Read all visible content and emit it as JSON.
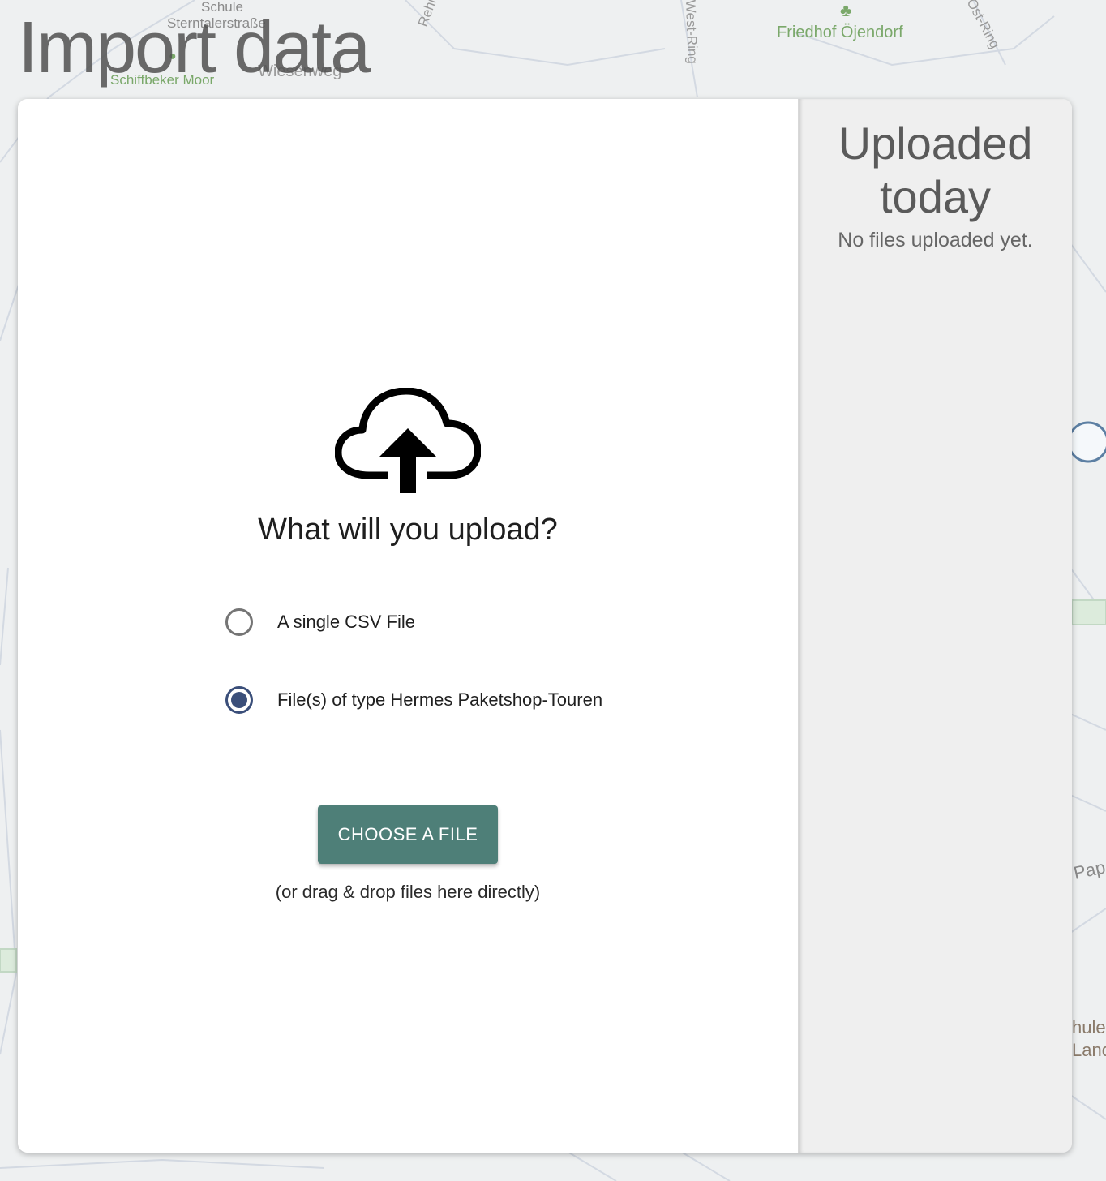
{
  "page": {
    "title": "Import data"
  },
  "map": {
    "labels": [
      "Schule",
      "Sterntalerstraße",
      "Schiffbeker Moor",
      "Friedhof Öjendorf",
      "West-Ring",
      "Ost-Ring",
      "Rehm",
      "Wiesenweg",
      "Pap",
      "hule",
      "Land"
    ]
  },
  "upload": {
    "question": "What will you upload?",
    "options": [
      {
        "label": "A single CSV File",
        "selected": false
      },
      {
        "label": "File(s) of type Hermes Paketshop-Touren",
        "selected": true
      }
    ],
    "choose_button": "CHOOSE A FILE",
    "drag_hint": "(or drag & drop files here directly)"
  },
  "uploaded": {
    "title": "Uploaded today",
    "empty_text": "No files uploaded yet."
  },
  "colors": {
    "accent": "#4e7f78",
    "radio_selected": "#3b4f7a",
    "map_park_label": "#7aa86a"
  }
}
